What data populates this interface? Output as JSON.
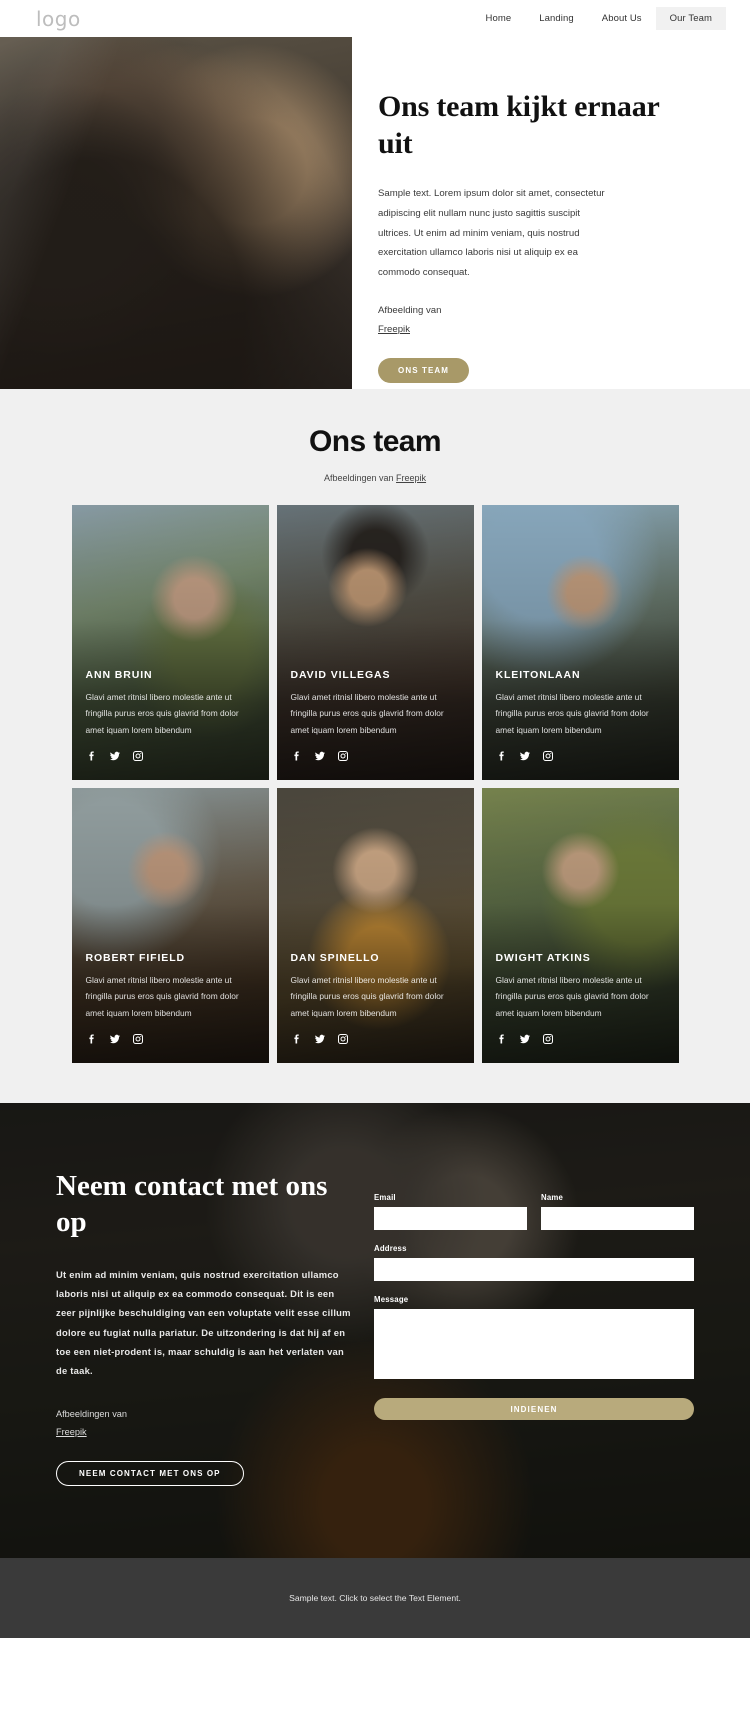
{
  "header": {
    "logo": "logo",
    "nav": [
      {
        "label": "Home",
        "active": false
      },
      {
        "label": "Landing",
        "active": false
      },
      {
        "label": "About Us",
        "active": false
      },
      {
        "label": "Our Team",
        "active": true
      }
    ]
  },
  "hero": {
    "title": "Ons team kijkt ernaar uit",
    "body": "Sample text. Lorem ipsum dolor sit amet, consectetur adipiscing elit nullam nunc justo sagittis suscipit ultrices. Ut enim ad minim veniam, quis nostrud exercitation ullamco laboris nisi ut aliquip ex ea commodo consequat.",
    "credit_prefix": "Afbeelding van",
    "credit_link": "Freepik",
    "cta": "ONS TEAM"
  },
  "team": {
    "title": "Ons team",
    "subtitle_prefix": "Afbeeldingen van",
    "subtitle_link": "Freepik",
    "members": [
      {
        "name": "ANN BRUIN",
        "desc": "Glavi amet ritnisl libero molestie ante ut fringilla purus eros quis glavrid from dolor amet iquam lorem bibendum"
      },
      {
        "name": "DAVID VILLEGAS",
        "desc": "Glavi amet ritnisl libero molestie ante ut fringilla purus eros quis glavrid from dolor amet iquam lorem bibendum"
      },
      {
        "name": "KLEITONLAAN",
        "desc": "Glavi amet ritnisl libero molestie ante ut fringilla purus eros quis glavrid from dolor amet iquam lorem bibendum"
      },
      {
        "name": "ROBERT FIFIELD",
        "desc": "Glavi amet ritnisl libero molestie ante ut fringilla purus eros quis glavrid from dolor amet iquam lorem bibendum"
      },
      {
        "name": "DAN SPINELLO",
        "desc": "Glavi amet ritnisl libero molestie ante ut fringilla purus eros quis glavrid from dolor amet iquam lorem bibendum"
      },
      {
        "name": "DWIGHT ATKINS",
        "desc": "Glavi amet ritnisl libero molestie ante ut fringilla purus eros quis glavrid from dolor amet iquam lorem bibendum"
      }
    ],
    "social_icons": [
      "facebook-icon",
      "twitter-icon",
      "instagram-icon"
    ]
  },
  "contact": {
    "title": "Neem contact met ons op",
    "body": "Ut enim ad minim veniam, quis nostrud exercitation ullamco laboris nisi ut aliquip ex ea commodo consequat. Dit is een zeer pijnlijke beschuldiging van een voluptate velit esse cillum dolore eu fugiat nulla pariatur. De uitzondering is dat hij af en toe een niet-prodent is, maar schuldig is aan het verlaten van de taak.",
    "credit_prefix": "Afbeeldingen van",
    "credit_link": "Freepik",
    "cta": "NEEM CONTACT MET ONS OP",
    "form": {
      "email_label": "Email",
      "email_value": "",
      "name_label": "Name",
      "name_value": "",
      "address_label": "Address",
      "address_value": "",
      "message_label": "Message",
      "message_value": "",
      "submit_label": "INDIENEN"
    }
  },
  "footer": {
    "text": "Sample text. Click to select the Text Element."
  },
  "colors": {
    "accent": "#a89968",
    "submit": "#b8aa7c",
    "team_bg": "#f0f0f0",
    "footer_bg": "#3a3a3a"
  }
}
